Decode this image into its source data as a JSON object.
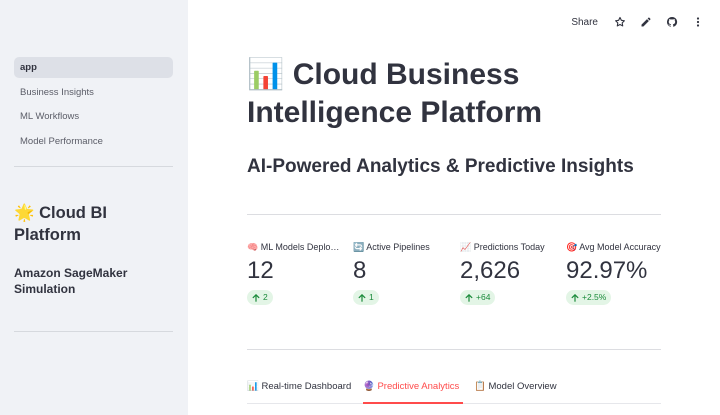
{
  "sidebar": {
    "nav": [
      {
        "label": "app",
        "active": true
      },
      {
        "label": "Business Insights"
      },
      {
        "label": "ML Workflows"
      },
      {
        "label": "Model Performance"
      }
    ],
    "title": "🌟 Cloud BI Platform",
    "subtitle": "Amazon SageMaker Simulation"
  },
  "toolbar": {
    "share_label": "Share",
    "icons": [
      "star-icon",
      "pencil-icon",
      "github-icon",
      "more-vertical-icon"
    ]
  },
  "main": {
    "title": "📊 Cloud Business Intelligence Platform",
    "subtitle": "AI-Powered Analytics & Predictive Insights",
    "metrics": [
      {
        "label": "🧠 ML Models Deployed",
        "value": "12",
        "delta": "2"
      },
      {
        "label": "🔄 Active Pipelines",
        "value": "8",
        "delta": "1"
      },
      {
        "label": "📈 Predictions Today",
        "value": "2,626",
        "delta": "+64"
      },
      {
        "label": "🎯 Avg Model Accuracy",
        "value": "92.97%",
        "delta": "+2.5%"
      }
    ],
    "tabs": [
      {
        "label": "📊 Real-time Dashboard"
      },
      {
        "label": "🔮 Predictive Analytics",
        "active": true
      },
      {
        "label": "📋 Model Overview"
      }
    ]
  },
  "colors": {
    "accent": "#ff4b4b",
    "sidebar_bg": "#f0f2f6",
    "delta_text": "#1a8a3a",
    "delta_bg": "#e3f5e6"
  }
}
